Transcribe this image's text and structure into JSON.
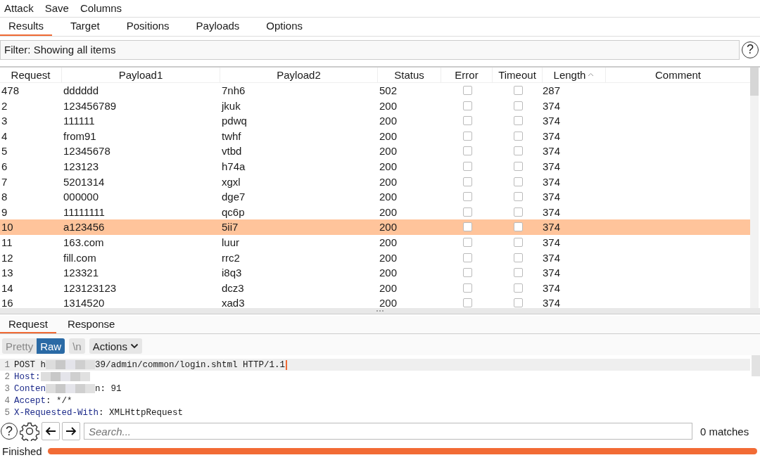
{
  "menu": [
    "Attack",
    "Save",
    "Columns"
  ],
  "tabs": [
    {
      "label": "Results",
      "selected": true
    },
    {
      "label": "Target",
      "selected": false
    },
    {
      "label": "Positions",
      "selected": false
    },
    {
      "label": "Payloads",
      "selected": false
    },
    {
      "label": "Options",
      "selected": false
    }
  ],
  "filter": {
    "text": "Filter: Showing all items",
    "help": "?"
  },
  "table": {
    "columns": [
      {
        "label": "Request",
        "kind": "text"
      },
      {
        "label": "Payload1",
        "kind": "text"
      },
      {
        "label": "Payload2",
        "kind": "text"
      },
      {
        "label": "Status",
        "kind": "text"
      },
      {
        "label": "Error",
        "kind": "check"
      },
      {
        "label": "Timeout",
        "kind": "check"
      },
      {
        "label": "Length",
        "kind": "text",
        "sorted": true
      },
      {
        "label": "Comment",
        "kind": "text"
      }
    ],
    "rows": [
      {
        "cells": [
          "478",
          "dddddd",
          "7nh6",
          "502",
          "",
          "",
          "287",
          ""
        ],
        "error": false,
        "timeout": false,
        "selected": false
      },
      {
        "cells": [
          "2",
          "123456789",
          "jkuk",
          "200",
          "",
          "",
          "374",
          ""
        ],
        "error": false,
        "timeout": false,
        "selected": false
      },
      {
        "cells": [
          "3",
          "111111",
          "pdwq",
          "200",
          "",
          "",
          "374",
          ""
        ],
        "error": false,
        "timeout": false,
        "selected": false
      },
      {
        "cells": [
          "4",
          "from91",
          "twhf",
          "200",
          "",
          "",
          "374",
          ""
        ],
        "error": false,
        "timeout": false,
        "selected": false
      },
      {
        "cells": [
          "5",
          "12345678",
          "vtbd",
          "200",
          "",
          "",
          "374",
          ""
        ],
        "error": false,
        "timeout": false,
        "selected": false
      },
      {
        "cells": [
          "6",
          "123123",
          "h74a",
          "200",
          "",
          "",
          "374",
          ""
        ],
        "error": false,
        "timeout": false,
        "selected": false
      },
      {
        "cells": [
          "7",
          "5201314",
          "xgxl",
          "200",
          "",
          "",
          "374",
          ""
        ],
        "error": false,
        "timeout": false,
        "selected": false
      },
      {
        "cells": [
          "8",
          "000000",
          "dge7",
          "200",
          "",
          "",
          "374",
          ""
        ],
        "error": false,
        "timeout": false,
        "selected": false
      },
      {
        "cells": [
          "9",
          "11111111",
          "qc6p",
          "200",
          "",
          "",
          "374",
          ""
        ],
        "error": false,
        "timeout": false,
        "selected": false
      },
      {
        "cells": [
          "10",
          "a123456",
          "5ii7",
          "200",
          "",
          "",
          "374",
          ""
        ],
        "error": false,
        "timeout": false,
        "selected": true
      },
      {
        "cells": [
          "11",
          "163.com",
          "luur",
          "200",
          "",
          "",
          "374",
          ""
        ],
        "error": false,
        "timeout": false,
        "selected": false
      },
      {
        "cells": [
          "12",
          "fill.com",
          "rrc2",
          "200",
          "",
          "",
          "374",
          ""
        ],
        "error": false,
        "timeout": false,
        "selected": false
      },
      {
        "cells": [
          "13",
          "123321",
          "i8q3",
          "200",
          "",
          "",
          "374",
          ""
        ],
        "error": false,
        "timeout": false,
        "selected": false
      },
      {
        "cells": [
          "14",
          "123123123",
          "dcz3",
          "200",
          "",
          "",
          "374",
          ""
        ],
        "error": false,
        "timeout": false,
        "selected": false
      },
      {
        "cells": [
          "16",
          "1314520",
          "xad3",
          "200",
          "",
          "",
          "374",
          ""
        ],
        "error": false,
        "timeout": false,
        "selected": false
      }
    ]
  },
  "message_tabs": [
    {
      "label": "Request",
      "selected": true
    },
    {
      "label": "Response",
      "selected": false
    }
  ],
  "view_buttons": [
    {
      "label": "Pretty",
      "selected": false
    },
    {
      "label": "Raw",
      "selected": true
    },
    {
      "label": "\\n",
      "selected": false
    }
  ],
  "actions": "Actions",
  "editor_lines": [
    {
      "number": "1",
      "parts": [
        {
          "kind": "plain",
          "text": "POST h"
        },
        {
          "kind": "blur"
        },
        {
          "kind": "plain",
          "text": "39/admin/common/login.shtml HTTP/1.1"
        }
      ],
      "current": true
    },
    {
      "number": "2",
      "parts": [
        {
          "kind": "key",
          "text": "Host:"
        },
        {
          "kind": "blur"
        }
      ]
    },
    {
      "number": "3",
      "parts": [
        {
          "kind": "key",
          "text": "Conten"
        },
        {
          "kind": "blur"
        },
        {
          "kind": "plain",
          "text": "n: 91"
        }
      ]
    },
    {
      "number": "4",
      "parts": [
        {
          "kind": "key",
          "text": "Accept"
        },
        {
          "kind": "plain",
          "text": ": */*"
        }
      ]
    },
    {
      "number": "5",
      "parts": [
        {
          "kind": "key",
          "text": "X-Requested-With"
        },
        {
          "kind": "plain",
          "text": ": XMLHttpRequest"
        }
      ]
    }
  ],
  "search": {
    "help": "?",
    "placeholder": "Search...",
    "matches": "0 matches"
  },
  "status_bar": {
    "text": "Finished",
    "level": 1
  }
}
